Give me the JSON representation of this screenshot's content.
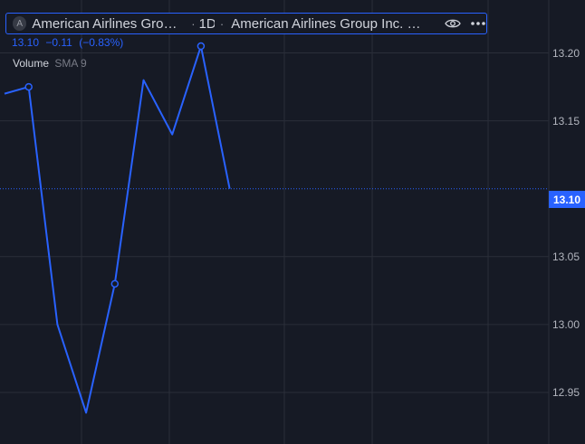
{
  "legend": {
    "badge": "A",
    "short_title": "American Airlines Group Inc.",
    "separator": "·",
    "interval": "1D",
    "separator2": "·",
    "long_title": "American Airlines Group Inc. Common Stock",
    "eye_icon": "eye-icon",
    "more_icon": "more-icon"
  },
  "price": {
    "last": "13.10",
    "change": "−0.11",
    "change_pct": "(−0.83%)"
  },
  "volume": {
    "label": "Volume",
    "indicator": "SMA 9"
  },
  "colors": {
    "background": "#161a25",
    "line": "#2962ff",
    "grid": "#2a2e39",
    "text": "#b2b5be"
  },
  "chart_data": {
    "type": "line",
    "x": [
      0,
      1,
      2,
      3,
      4,
      5,
      6,
      7,
      8
    ],
    "values": [
      13.17,
      13.175,
      13.0,
      12.935,
      13.03,
      13.18,
      13.14,
      13.205,
      13.1
    ],
    "markers": [
      1,
      4,
      7
    ],
    "y_ticks": [
      "13.20",
      "13.15",
      "13.10",
      "13.05",
      "13.00",
      "12.95"
    ],
    "y_tick_values": [
      13.2,
      13.15,
      13.1,
      13.05,
      13.0,
      12.95
    ],
    "ylim": [
      12.912,
      13.239
    ],
    "last_price": 13.1,
    "last_price_label": "13.10",
    "grid": true
  }
}
